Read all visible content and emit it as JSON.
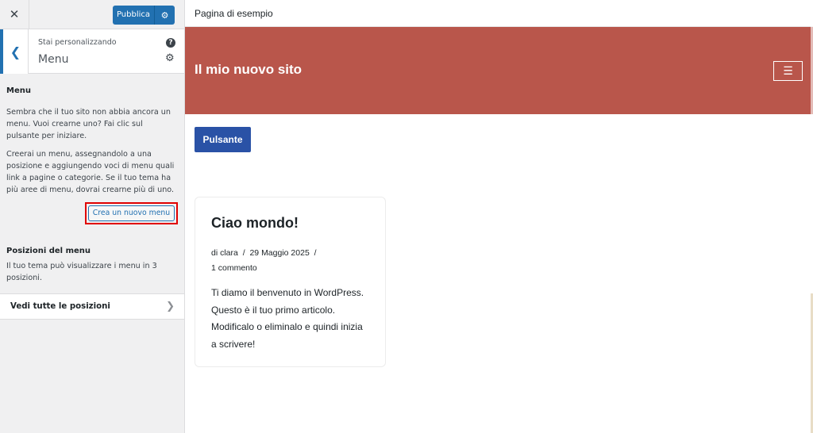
{
  "sidebar": {
    "close_icon": "close-icon",
    "publish_label": "Pubblica",
    "customizing_label": "Stai personalizzando",
    "section_title": "Menu",
    "panel": {
      "heading": "Menu",
      "p1": "Sembra che il tuo sito non abbia ancora un menu. Vuoi crearne uno? Fai clic sul pulsante per iniziare.",
      "p2": "Creerai un menu, assegnandolo a una posizione e aggiungendo voci di menu quali link a pagine o categorie. Se il tuo tema ha più aree di menu, dovrai crearne più di uno.",
      "create_button": "Crea un nuovo menu",
      "positions_heading": "Posizioni del menu",
      "positions_desc": "Il tuo tema può visualizzare i menu in 3 posizioni.",
      "view_positions": "Vedi tutte le posizioni"
    }
  },
  "preview": {
    "page_label": "Pagina di esempio",
    "site_title": "Il mio nuovo sito",
    "button_label": "Pulsante",
    "post": {
      "title": "Ciao mondo!",
      "by": "di clara",
      "sep1": "/",
      "date": "29 Maggio 2025",
      "sep2": "/",
      "comments": "1 commento",
      "excerpt": "Ti diamo il benvenuto in WordPress. Questo è il tuo primo articolo. Modificalo o eliminalo e quindi inizia a scrivere!"
    }
  },
  "colors": {
    "accent": "#2271b1",
    "header_bg": "#b9564b",
    "button_bg": "#2a52a6",
    "highlight": "#e00000"
  }
}
